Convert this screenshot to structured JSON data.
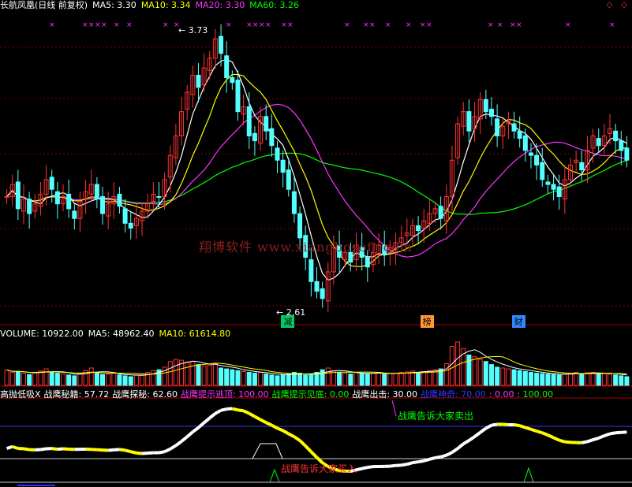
{
  "main": {
    "title": "长航凤凰(日线 前复权)",
    "ma5": "MA5: 3.30",
    "ma10": "MA10: 3.34",
    "ma20": "MA20: 3.30",
    "ma60": "MA60: 3.26",
    "high_label": "3.73",
    "low_label": "2.61",
    "watermark": "翔博软件 www.xiangbosoft.com",
    "markers": [
      {
        "text": "减",
        "color": "#00cc66",
        "pos": 0.445
      },
      {
        "text": "榜",
        "color": "#ff9933",
        "pos": 0.665
      },
      {
        "text": "财",
        "color": "#3388ff",
        "pos": 0.81
      }
    ],
    "colors": {
      "ma5": "#ffffff",
      "ma10": "#ffff00",
      "ma20": "#ff33ff",
      "ma60": "#00ff00",
      "up": "#ff3232",
      "down": "#54ffff"
    }
  },
  "volume": {
    "label": "VOLUME: 10922.00",
    "ma5": "MA5: 48962.40",
    "ma10": "MA10: 61614.80"
  },
  "indicator": {
    "name": "高抛低吸X",
    "items": [
      {
        "text": "战鹰秘籍: 57.72",
        "color": "#ffffff"
      },
      {
        "text": "战鹰探秘: 62.60",
        "color": "#ffffff"
      },
      {
        "text": "战鹰提示逃顶: 100.00",
        "color": "#ff33ff"
      },
      {
        "text": "战鹰提示见底: 0.00",
        "color": "#00ff00"
      },
      {
        "text": "战鹰出击: 30.00",
        "color": "#ffffff"
      },
      {
        "text": "战鹰神奇: 70.00",
        "color": "#3333ff"
      },
      {
        "text": ": 0.00",
        "color": "#ff33ff"
      },
      {
        "text": ": 100.00",
        "color": "#00ff00"
      }
    ],
    "sell_text": "战鹰告诉大家卖出",
    "buy_text": "战鹰告诉大家买入"
  },
  "chart_data": {
    "type": "candlestick+volume+indicator",
    "price_range": [
      2.61,
      3.73
    ],
    "close": [
      3.05,
      3.1,
      3.0,
      3.04,
      2.98,
      3.02,
      3.06,
      3.12,
      3.08,
      3.02,
      3.05,
      3.0,
      2.96,
      3.03,
      3.07,
      3.1,
      3.04,
      2.98,
      3.02,
      3.05,
      3.01,
      2.94,
      2.92,
      2.96,
      2.99,
      3.02,
      3.06,
      3.05,
      3.12,
      3.22,
      3.3,
      3.4,
      3.48,
      3.55,
      3.5,
      3.58,
      3.62,
      3.7,
      3.64,
      3.54,
      3.52,
      3.4,
      3.42,
      3.3,
      3.28,
      3.38,
      3.32,
      3.26,
      3.2,
      3.15,
      3.08,
      2.98,
      2.88,
      2.8,
      2.7,
      2.66,
      2.63,
      2.74,
      2.84,
      2.8,
      2.82,
      2.78,
      2.85,
      2.8,
      2.76,
      2.82,
      2.85,
      2.81,
      2.84,
      2.86,
      2.88,
      2.9,
      2.93,
      2.91,
      2.95,
      2.98,
      3.0,
      2.96,
      3.05,
      3.2,
      3.35,
      3.4,
      3.32,
      3.38,
      3.45,
      3.4,
      3.38,
      3.3,
      3.34,
      3.36,
      3.32,
      3.29,
      3.24,
      3.22,
      3.18,
      3.12,
      3.1,
      3.08,
      3.05,
      3.12,
      3.18,
      3.2,
      3.16,
      3.24,
      3.3,
      3.26,
      3.3,
      3.33,
      3.28,
      3.24,
      3.2
    ],
    "volume_rel": [
      0.35,
      0.3,
      0.32,
      0.28,
      0.25,
      0.3,
      0.33,
      0.38,
      0.3,
      0.28,
      0.26,
      0.24,
      0.22,
      0.28,
      0.34,
      0.4,
      0.3,
      0.25,
      0.26,
      0.28,
      0.24,
      0.22,
      0.2,
      0.24,
      0.26,
      0.3,
      0.34,
      0.36,
      0.42,
      0.55,
      0.6,
      0.58,
      0.52,
      0.55,
      0.48,
      0.44,
      0.46,
      0.5,
      0.4,
      0.38,
      0.36,
      0.34,
      0.32,
      0.3,
      0.28,
      0.3,
      0.26,
      0.24,
      0.22,
      0.24,
      0.26,
      0.3,
      0.28,
      0.24,
      0.26,
      0.3,
      0.36,
      0.4,
      0.34,
      0.3,
      0.28,
      0.26,
      0.3,
      0.28,
      0.26,
      0.28,
      0.3,
      0.26,
      0.27,
      0.28,
      0.3,
      0.31,
      0.33,
      0.3,
      0.32,
      0.34,
      0.36,
      0.38,
      0.5,
      0.9,
      1.0,
      0.85,
      0.7,
      0.66,
      0.6,
      0.55,
      0.48,
      0.42,
      0.4,
      0.38,
      0.36,
      0.34,
      0.32,
      0.3,
      0.28,
      0.27,
      0.26,
      0.25,
      0.24,
      0.26,
      0.28,
      0.3,
      0.27,
      0.29,
      0.3,
      0.28,
      0.27,
      0.26,
      0.24,
      0.22,
      0.2
    ],
    "indicator_range": [
      0,
      100
    ]
  }
}
